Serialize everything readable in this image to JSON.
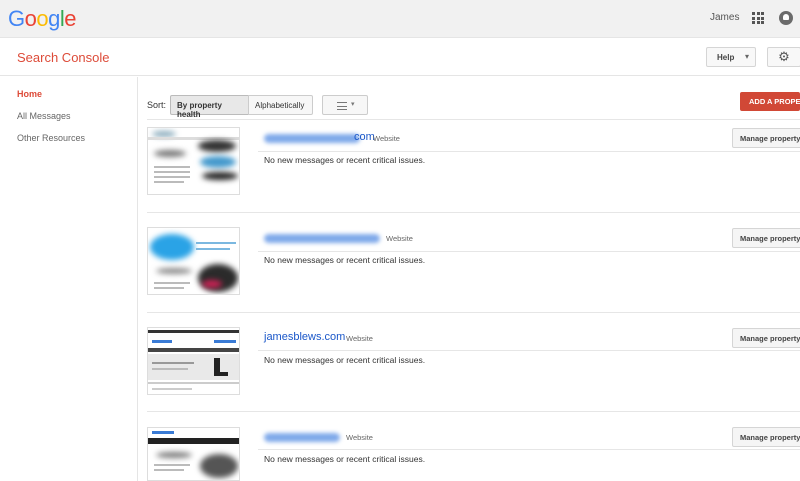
{
  "google_bar": {
    "logo_letters": [
      {
        "ch": "G",
        "color": "#4285f4"
      },
      {
        "ch": "o",
        "color": "#ea4335"
      },
      {
        "ch": "o",
        "color": "#fbbc05"
      },
      {
        "ch": "g",
        "color": "#4285f4"
      },
      {
        "ch": "l",
        "color": "#34a853"
      },
      {
        "ch": "e",
        "color": "#ea4335"
      }
    ],
    "user_name": "James",
    "apps_icon": "apps-grid-icon",
    "notifications_icon": "bell-icon"
  },
  "header": {
    "title": "Search Console",
    "help_label": "Help",
    "settings_icon": "gear-icon"
  },
  "sidebar": {
    "items": [
      {
        "label": "Home",
        "active": true
      },
      {
        "label": "All Messages",
        "active": false
      },
      {
        "label": "Other Resources",
        "active": false
      }
    ]
  },
  "toolbar": {
    "sort_label": "Sort:",
    "sort_options": [
      "By property health",
      "Alphabetically"
    ],
    "selected_sort": "By property health",
    "add_property_label": "ADD A PROPERTY",
    "view_icon": "list-view-icon"
  },
  "properties": [
    {
      "name": "com",
      "name_visible": false,
      "type": "Website",
      "message": "No new messages or recent critical issues.",
      "manage_label": "Manage property"
    },
    {
      "name": "",
      "name_visible": false,
      "type": "Website",
      "message": "No new messages or recent critical issues.",
      "manage_label": "Manage property"
    },
    {
      "name": "jamesblews.com",
      "name_visible": true,
      "type": "Website",
      "message": "No new messages or recent critical issues.",
      "manage_label": "Manage property"
    },
    {
      "name": "",
      "name_visible": false,
      "type": "Website",
      "message": "No new messages or recent critical issues.",
      "manage_label": "Manage property"
    }
  ],
  "colors": {
    "brand_red": "#dd4b39",
    "add_button": "#d14836",
    "link_blue": "#1a57c9"
  }
}
